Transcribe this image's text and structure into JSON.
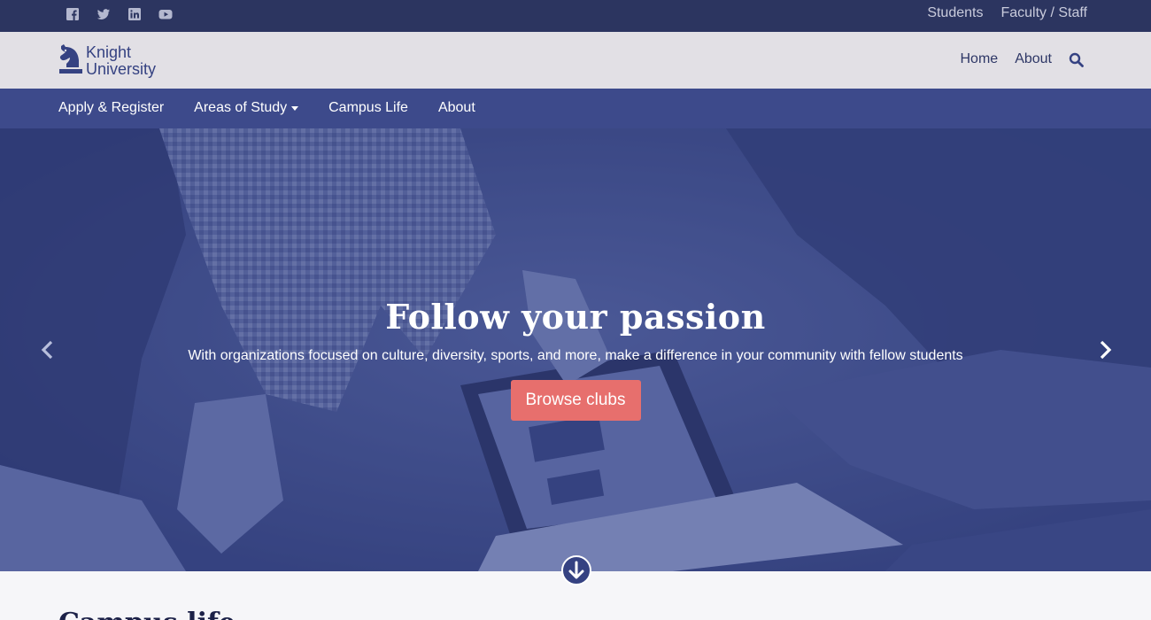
{
  "topbar": {
    "social_icons": [
      "facebook-icon",
      "twitter-icon",
      "linkedin-icon",
      "youtube-icon"
    ],
    "links": {
      "students": "Students",
      "faculty_staff": "Faculty / Staff"
    }
  },
  "brand": {
    "logo_line1": "Knight",
    "logo_line2": "University",
    "nav": {
      "home": "Home",
      "about": "About"
    },
    "search_icon": "search-icon"
  },
  "mainnav": {
    "items": [
      {
        "label": "Apply & Register"
      },
      {
        "label": "Areas of Study"
      },
      {
        "label": "Campus Life"
      },
      {
        "label": "About"
      }
    ]
  },
  "hero": {
    "title": "Follow your passion",
    "subtitle": "With organizations focused on culture, diversity, sports, and more, make a difference in your community with fellow students",
    "button": "Browse clubs",
    "prev_icon": "chevron-left-icon",
    "next_icon": "chevron-right-icon"
  },
  "below": {
    "scroll_icon": "arrow-down-circle-icon",
    "section_title": "Campus life"
  },
  "colors": {
    "topbar": "#2c3560",
    "brandbar": "#e2e0e5",
    "mainnav": "#3d4a8b",
    "accent": "#e76f6d",
    "hero_tint": "#3b4a86"
  }
}
